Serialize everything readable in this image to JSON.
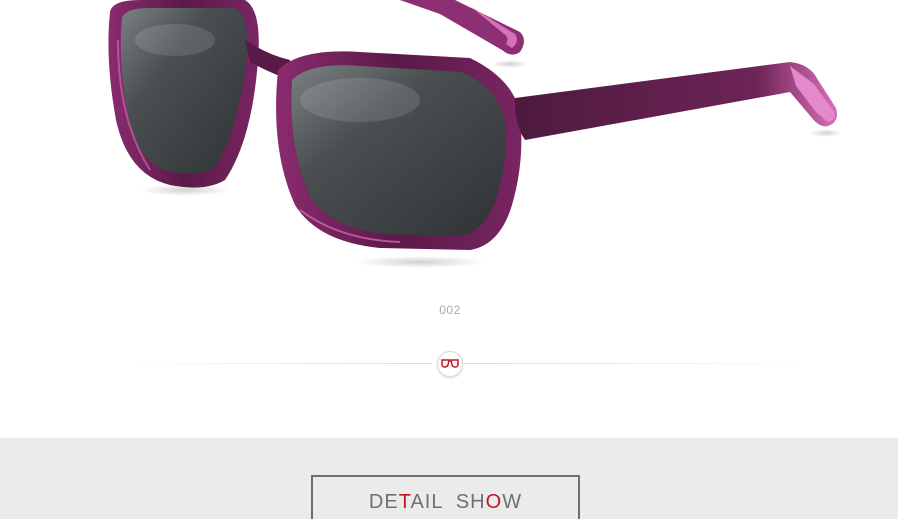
{
  "product": {
    "variant_code": "002",
    "frame_color": "#6a1f52",
    "temple_tip_color": "#d86fb8",
    "lens_color": "#3d4244"
  },
  "detail_section": {
    "title_parts": [
      {
        "text": "DE",
        "accent": false
      },
      {
        "text": "T",
        "accent": true
      },
      {
        "text": "AIL  SH",
        "accent": false
      },
      {
        "text": "O",
        "accent": true
      },
      {
        "text": "W",
        "accent": false
      }
    ],
    "accent_color": "#c2161e",
    "band_color": "#ebebeb"
  },
  "divider": {
    "icon": "glasses-icon"
  }
}
